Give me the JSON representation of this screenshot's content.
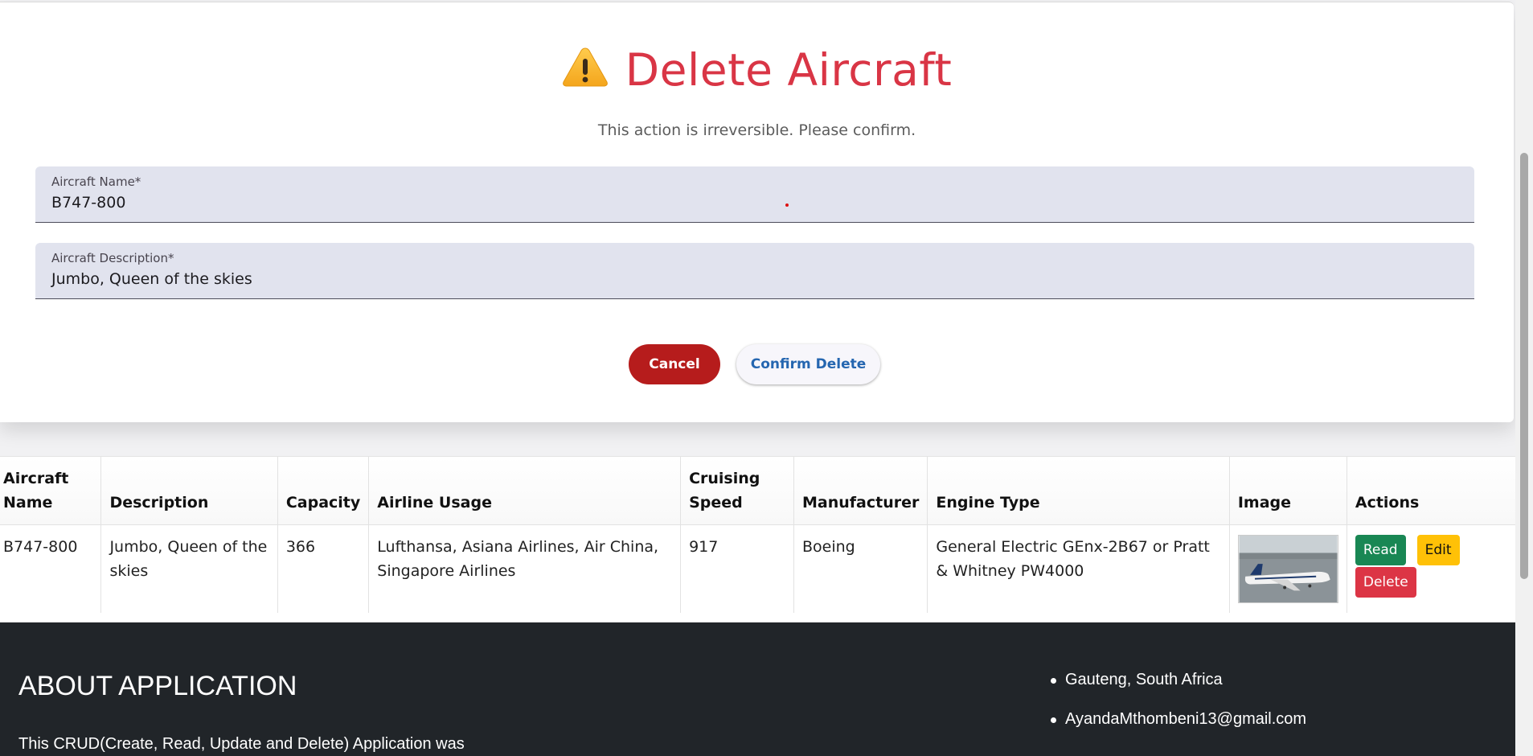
{
  "dialog": {
    "title": "Delete Aircraft",
    "warning_icon": "warning-icon",
    "subtitle": "This action is irreversible. Please confirm.",
    "fields": {
      "name_label": "Aircraft Name*",
      "name_value": "B747-800",
      "description_label": "Aircraft Description*",
      "description_value": "Jumbo, Queen of the skies"
    },
    "cancel_label": "Cancel",
    "confirm_label": "Confirm Delete"
  },
  "table": {
    "headers": [
      "Aircraft Name",
      "Description",
      "Capacity",
      "Airline Usage",
      "Cruising Speed",
      "Manufacturer",
      "Engine Type",
      "Image",
      "Actions"
    ],
    "rows": [
      {
        "name": "B747-800",
        "description": "Jumbo, Queen of the skies",
        "capacity": "366",
        "airline_usage": "Lufthansa, Asiana Airlines, Air China, Singapore Airlines",
        "cruising_speed": "917",
        "manufacturer": "Boeing",
        "engine_type": "General Electric GEnx-2B67 or Pratt & Whitney PW4000",
        "image": "aircraft-photo",
        "actions": {
          "read": "Read",
          "edit": "Edit",
          "delete": "Delete"
        }
      }
    ]
  },
  "footer": {
    "about_title": "ABOUT APPLICATION",
    "about_text": "This CRUD(Create, Read, Update and Delete) Application was",
    "contact": [
      "Gauteng, South Africa",
      "AyandaMthombeni13@gmail.com"
    ]
  },
  "colors": {
    "danger": "#d93545",
    "cancel_bg": "#b61c1c",
    "confirm_text": "#2566b0",
    "read_btn": "#198754",
    "edit_btn": "#ffc107",
    "delete_btn": "#dc3545",
    "footer_bg": "#212529",
    "field_bg": "#e1e3ee"
  }
}
